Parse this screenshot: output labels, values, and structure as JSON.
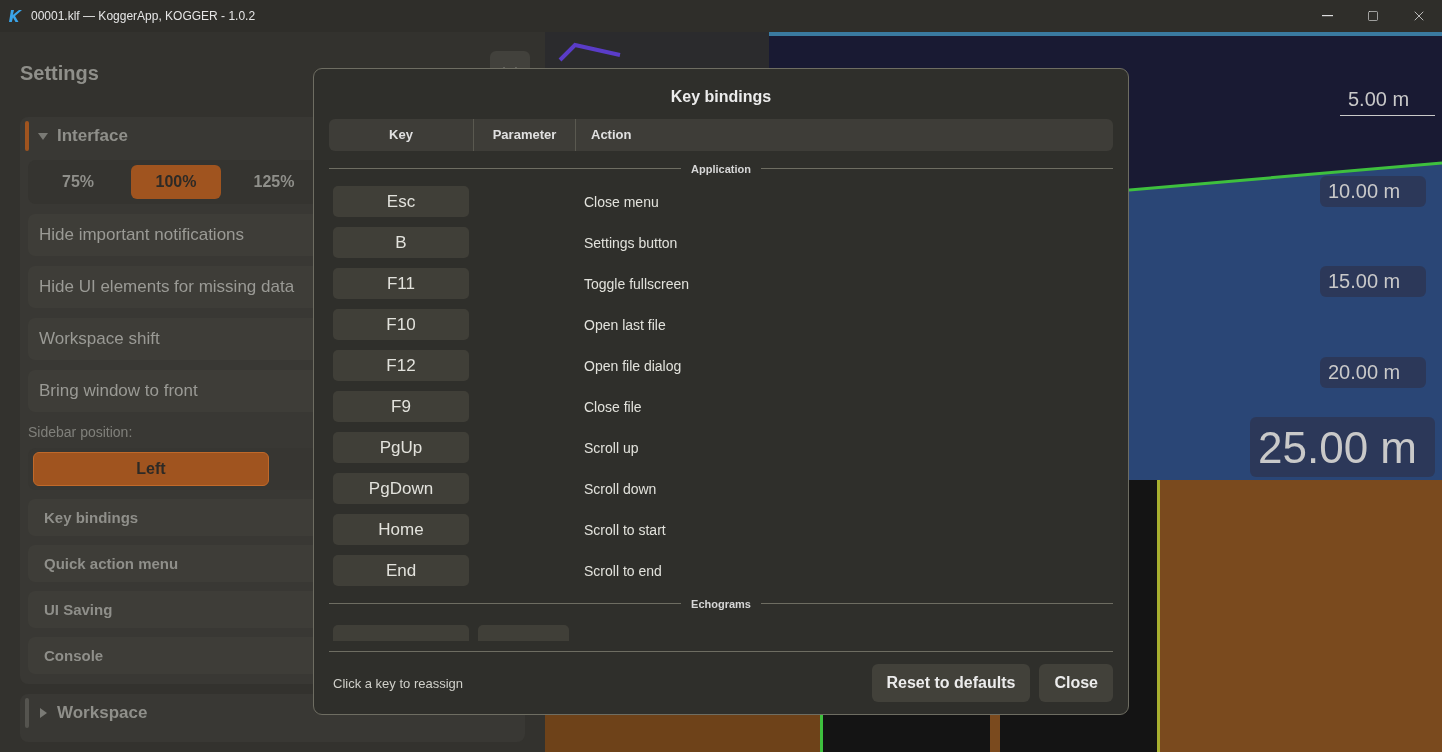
{
  "window": {
    "title": "00001.klf — KoggerApp, KOGGER - 1.0.2"
  },
  "settings": {
    "title": "Settings",
    "sections": [
      {
        "title": "Interface",
        "expanded": true,
        "scale_options": [
          {
            "label": "75%",
            "selected": false
          },
          {
            "label": "100%",
            "selected": true
          },
          {
            "label": "125%",
            "selected": false
          }
        ],
        "toggles": [
          "Hide important notifications",
          "Hide UI elements for missing data",
          "Workspace shift",
          "Bring window to front"
        ],
        "sidebar_position": {
          "label": "Sidebar position:",
          "options": [
            {
              "label": "Left",
              "selected": true
            }
          ]
        },
        "groups": [
          "Key bindings",
          "Quick action menu",
          "UI Saving",
          "Console"
        ]
      },
      {
        "title": "Workspace",
        "expanded": false
      }
    ]
  },
  "echogram": {
    "depth_labels": [
      "5.00 m",
      "10.00 m",
      "15.00 m",
      "20.00 m"
    ],
    "current_depth": "25.00 m"
  },
  "dialog": {
    "title": "Key bindings",
    "columns": [
      "Key",
      "Parameter",
      "Action"
    ],
    "groups": [
      {
        "title": "Application",
        "bindings": [
          {
            "key": "Esc",
            "action": "Close menu"
          },
          {
            "key": "B",
            "action": "Settings button"
          },
          {
            "key": "F11",
            "action": "Toggle fullscreen"
          },
          {
            "key": "F10",
            "action": "Open last file"
          },
          {
            "key": "F12",
            "action": "Open file dialog"
          },
          {
            "key": "F9",
            "action": "Close file"
          },
          {
            "key": "PgUp",
            "action": "Scroll up"
          },
          {
            "key": "PgDown",
            "action": "Scroll down"
          },
          {
            "key": "Home",
            "action": "Scroll to start"
          },
          {
            "key": "End",
            "action": "Scroll to end"
          }
        ]
      },
      {
        "title": "Echograms",
        "partial_row": true
      }
    ],
    "hint": "Click a key to reassign",
    "buttons": [
      "Reset to defaults",
      "Close"
    ]
  }
}
